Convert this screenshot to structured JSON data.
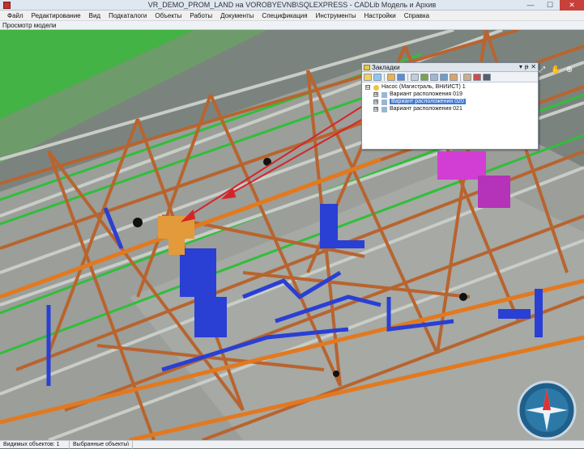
{
  "window": {
    "title": "VR_DEMO_PROM_LAND на VOROBYEVNB\\SQLEXPRESS - CADLib Модель и Архив",
    "controls": {
      "minimize": "—",
      "maximize": "☐",
      "close": "✕"
    }
  },
  "menu": {
    "items": [
      "Файл",
      "Редактирование",
      "Вид",
      "Подкаталоги",
      "Объекты",
      "Работы",
      "Документы",
      "Спецификация",
      "Инструменты",
      "Настройки",
      "Справка"
    ]
  },
  "panel_caption": "Просмотр модели",
  "bookmarks_panel": {
    "title": "Закладки",
    "controls": {
      "pin": "▾",
      "autohide": "ᵽ",
      "close": "✕"
    },
    "toolbar_icons": [
      "new-bookmark-icon",
      "add-icon",
      "folder-icon",
      "save-icon",
      "link-icon",
      "camera-icon",
      "grid-icon",
      "copy-icon",
      "paste-icon",
      "settings-icon",
      "filter-icon",
      "car-icon"
    ],
    "tree": {
      "root": {
        "label": "Насос (Магистраль, ВНИИСТ) 1",
        "expander": "⊟"
      },
      "children": [
        {
          "label": "Вариант расположения 019",
          "expander": "⊞",
          "selected": false
        },
        {
          "label": "Вариант расположения 020",
          "expander": "⊞",
          "selected": true
        },
        {
          "label": "Вариант расположения 021",
          "expander": "⊞",
          "selected": false
        }
      ]
    }
  },
  "nav_icons": [
    "rotate-icon",
    "arrows-icon",
    "hand-icon",
    "zoom-icon"
  ],
  "status": {
    "visible_objects": "Видимых объектов: 1",
    "selected_objects": "Выбранные объекты\\"
  },
  "colors": {
    "titlebar": "#dfe7f0",
    "menubar": "#f0f0f0",
    "steel": "#b8642f",
    "pipe_blue": "#2a3fd4",
    "pipe_orange": "#e3791f",
    "green_frame": "#2fbf3a",
    "pump_magenta": "#d23ed4",
    "arrow_red": "#d3262a",
    "selection": "#3a78d8"
  }
}
